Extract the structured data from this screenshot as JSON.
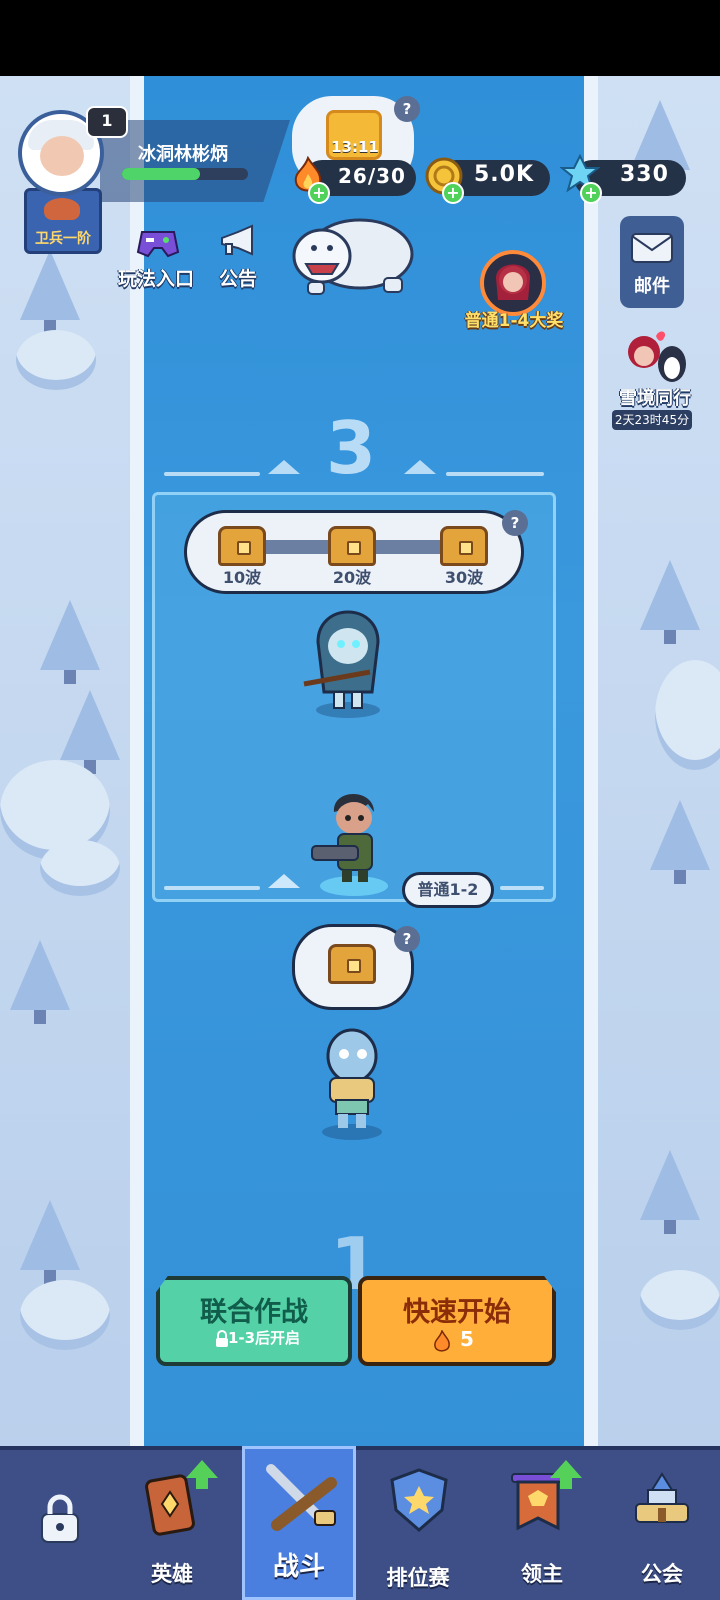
{
  "player": {
    "level": "1",
    "name": "冰洞林彬炳",
    "rank": "卫兵一阶",
    "xp_fraction": 0.62
  },
  "links": {
    "gameplay": "玩法入口",
    "notice": "公告"
  },
  "timer": "13:11",
  "resources": {
    "stamina": "26/30",
    "gold": "5.0K",
    "gems": "330"
  },
  "help_mark": "?",
  "event": {
    "label": "普通1-4大奖"
  },
  "mail": {
    "label": "邮件"
  },
  "snow_event": {
    "label": "雪境同行",
    "countdown": "2天23时45分"
  },
  "stage": {
    "next_number": "3",
    "current_number": "1",
    "current_tag": "普通1-2",
    "waves": [
      {
        "label": "10波"
      },
      {
        "label": "20波"
      },
      {
        "label": "30波"
      }
    ]
  },
  "buttons": {
    "coop_title": "联合作战",
    "coop_sub": "1-3后开启",
    "quick_title": "快速开始",
    "quick_cost": "5"
  },
  "nav": {
    "heroes": "英雄",
    "battle": "战斗",
    "ranked": "排位赛",
    "lord": "领主",
    "guild": "公会"
  },
  "icons": {
    "lock": "lock-icon",
    "stamina": "flame-icon",
    "gold": "coin-icon",
    "gems": "crystal-icon",
    "mail": "envelope-icon",
    "chest": "chest-icon",
    "gameplay": "controller-icon",
    "notice": "megaphone-icon"
  },
  "colors": {
    "river": "#3491d8",
    "snow": "#cfe0f4",
    "coop_button": "#54d1a6",
    "quick_button": "#ffae3a",
    "nav_bg": "#3d4f86",
    "nav_active": "#4a7fe0"
  }
}
